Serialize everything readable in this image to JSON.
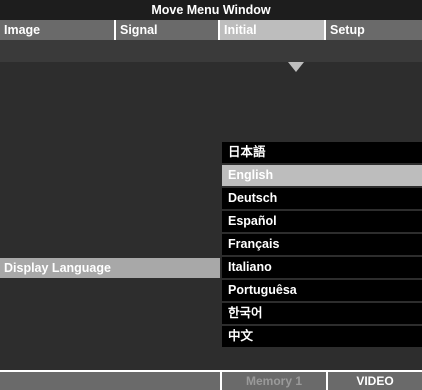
{
  "window": {
    "title": "Move Menu Window"
  },
  "tabs": [
    {
      "label": "Image",
      "active": false
    },
    {
      "label": "Signal",
      "active": false
    },
    {
      "label": "Initial",
      "active": true
    },
    {
      "label": "Setup",
      "active": false
    }
  ],
  "setting": {
    "label": "Display Language"
  },
  "languages": [
    {
      "label": "日本語",
      "selected": false
    },
    {
      "label": "English",
      "selected": true
    },
    {
      "label": "Deutsch",
      "selected": false
    },
    {
      "label": "Español",
      "selected": false
    },
    {
      "label": "Français",
      "selected": false
    },
    {
      "label": "Italiano",
      "selected": false
    },
    {
      "label": "Portuguêsa",
      "selected": false
    },
    {
      "label": "한국어",
      "selected": false
    },
    {
      "label": "中文",
      "selected": false
    }
  ],
  "status": {
    "memory": "Memory 1",
    "source": "VIDEO"
  },
  "colors": {
    "title_bar": "#1d1d1d",
    "tab_inactive": "#6a6a6a",
    "tab_active": "#bdbdbd",
    "panel": "#2d2d2d",
    "list_item": "#000000",
    "list_selected": "#bdbdbd",
    "highlight_row": "#a8a8a8"
  }
}
